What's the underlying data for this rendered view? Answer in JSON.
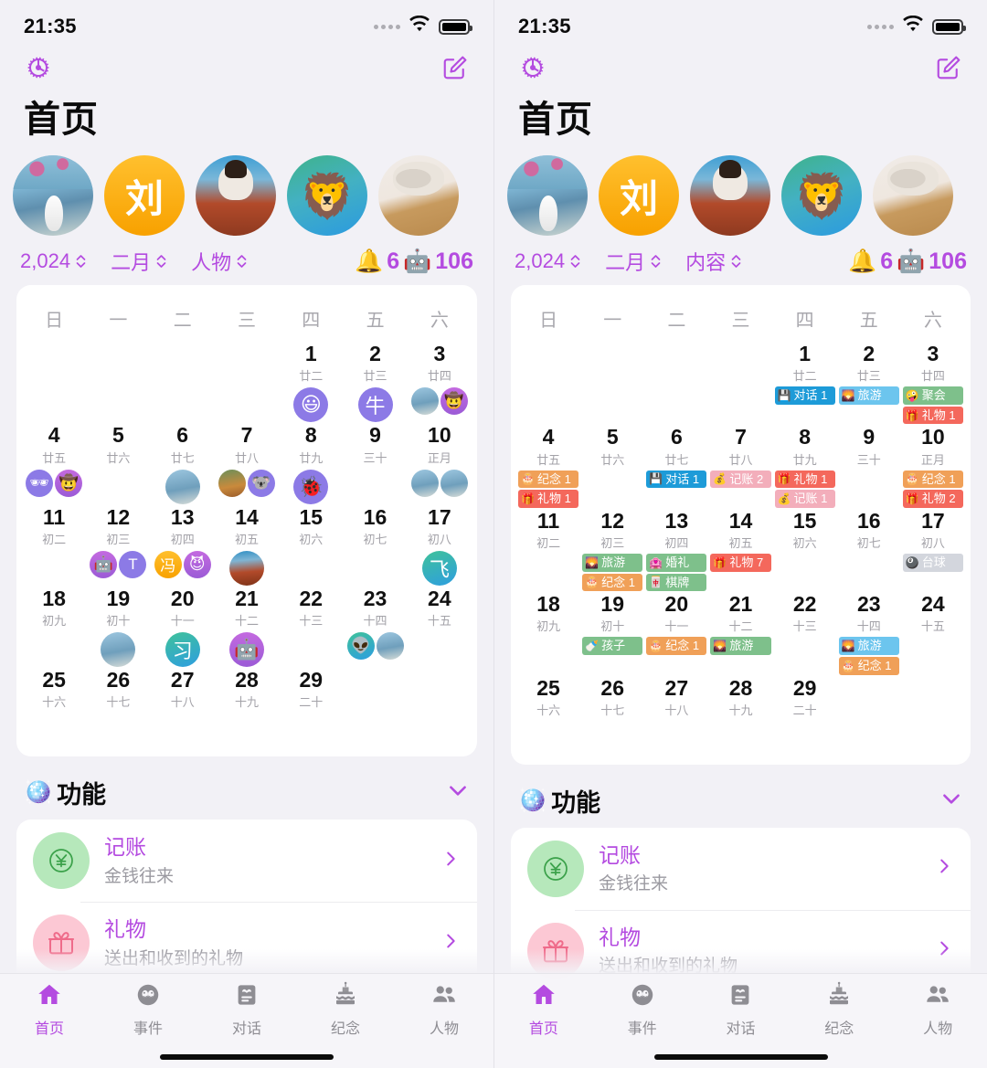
{
  "status_bar": {
    "time": "21:35",
    "wifi_icon": "wifi-icon",
    "battery_icon": "battery-icon"
  },
  "nav": {
    "settings_icon": "gear-icon",
    "compose_icon": "compose-icon"
  },
  "header": {
    "title": "首页"
  },
  "avatars": [
    {
      "name": "avatar-photo-lake",
      "kind": "photo",
      "label": ""
    },
    {
      "name": "avatar-letter-liu",
      "kind": "letter",
      "label": "刘"
    },
    {
      "name": "avatar-photo-cooking",
      "kind": "photo",
      "label": ""
    },
    {
      "name": "avatar-emoji-lion",
      "kind": "emoji",
      "label": "🦁"
    },
    {
      "name": "avatar-photo-table",
      "kind": "photo",
      "label": ""
    }
  ],
  "filters_left": [
    {
      "label": "2,024",
      "name": "year-selector"
    },
    {
      "label": "二月",
      "name": "month-selector"
    },
    {
      "label": "人物",
      "name": "view-selector"
    }
  ],
  "filters_right": [
    {
      "label": "2,024",
      "name": "year-selector"
    },
    {
      "label": "二月",
      "name": "month-selector"
    },
    {
      "label": "内容",
      "name": "view-selector"
    }
  ],
  "counters": {
    "bell_emoji": "🔔",
    "bell_count": "6",
    "robot_emoji": "🤖",
    "robot_count": "106"
  },
  "calendar": {
    "weekdays": [
      "日",
      "一",
      "二",
      "三",
      "四",
      "五",
      "六"
    ],
    "leading_blanks": 4,
    "days": [
      {
        "day": "1",
        "lunar": "廿二"
      },
      {
        "day": "2",
        "lunar": "廿三"
      },
      {
        "day": "3",
        "lunar": "廿四"
      },
      {
        "day": "4",
        "lunar": "廿五"
      },
      {
        "day": "5",
        "lunar": "廿六"
      },
      {
        "day": "6",
        "lunar": "廿七"
      },
      {
        "day": "7",
        "lunar": "廿八"
      },
      {
        "day": "8",
        "lunar": "廿九"
      },
      {
        "day": "9",
        "lunar": "三十"
      },
      {
        "day": "10",
        "lunar": "正月"
      },
      {
        "day": "11",
        "lunar": "初二"
      },
      {
        "day": "12",
        "lunar": "初三"
      },
      {
        "day": "13",
        "lunar": "初四"
      },
      {
        "day": "14",
        "lunar": "初五"
      },
      {
        "day": "15",
        "lunar": "初六"
      },
      {
        "day": "16",
        "lunar": "初七"
      },
      {
        "day": "17",
        "lunar": "初八"
      },
      {
        "day": "18",
        "lunar": "初九"
      },
      {
        "day": "19",
        "lunar": "初十"
      },
      {
        "day": "20",
        "lunar": "十一"
      },
      {
        "day": "21",
        "lunar": "十二"
      },
      {
        "day": "22",
        "lunar": "十三"
      },
      {
        "day": "23",
        "lunar": "十四"
      },
      {
        "day": "24",
        "lunar": "十五"
      },
      {
        "day": "25",
        "lunar": "十六"
      },
      {
        "day": "26",
        "lunar": "十七"
      },
      {
        "day": "27",
        "lunar": "十八"
      },
      {
        "day": "28",
        "lunar": "十九"
      },
      {
        "day": "29",
        "lunar": "二十"
      }
    ],
    "people_marks": {
      "1": [
        {
          "style": "d-purple",
          "glyph": "😃",
          "size": "big"
        }
      ],
      "2": [
        {
          "style": "d-purple",
          "glyph": "牛",
          "size": "big"
        }
      ],
      "3": [
        {
          "style": "d-pic1",
          "glyph": ""
        },
        {
          "style": "d-violet",
          "glyph": "🤠"
        }
      ],
      "4": [
        {
          "style": "d-purple",
          "glyph": "🕶"
        },
        {
          "style": "d-violet",
          "glyph": "🤠"
        }
      ],
      "6": [
        {
          "style": "d-pic1",
          "glyph": "",
          "size": "big"
        }
      ],
      "7": [
        {
          "style": "d-pic3",
          "glyph": ""
        },
        {
          "style": "d-purple",
          "glyph": "🐨"
        }
      ],
      "8": [
        {
          "style": "d-purple",
          "glyph": "🐞",
          "size": "big"
        }
      ],
      "10": [
        {
          "style": "d-pic1",
          "glyph": ""
        },
        {
          "style": "d-pic1",
          "glyph": ""
        }
      ],
      "12": [
        {
          "style": "d-violet",
          "glyph": "🤖"
        },
        {
          "style": "d-purple",
          "glyph": "T"
        }
      ],
      "13": [
        {
          "style": "d-orange",
          "glyph": "冯"
        },
        {
          "style": "d-violet",
          "glyph": "😈"
        }
      ],
      "14": [
        {
          "style": "d-pic2",
          "glyph": "",
          "size": "big"
        }
      ],
      "17": [
        {
          "style": "d-teal",
          "glyph": "飞",
          "size": "big"
        }
      ],
      "19": [
        {
          "style": "d-pic1",
          "glyph": "",
          "size": "big"
        }
      ],
      "20": [
        {
          "style": "d-teal",
          "glyph": "习",
          "size": "big"
        }
      ],
      "21": [
        {
          "style": "d-violet",
          "glyph": "🤖",
          "size": "big"
        }
      ],
      "23": [
        {
          "style": "d-teal",
          "glyph": "👽"
        },
        {
          "style": "d-pic1",
          "glyph": ""
        }
      ]
    },
    "events": {
      "1": [
        {
          "icon": "💾",
          "label": "对话 1",
          "color": "e-blue"
        }
      ],
      "2": [
        {
          "icon": "🌄",
          "label": "旅游",
          "color": "e-lightblue"
        }
      ],
      "3": [
        {
          "icon": "🤪",
          "label": "聚会",
          "color": "e-green"
        },
        {
          "icon": "🎁",
          "label": "礼物 1",
          "color": "e-red"
        }
      ],
      "4": [
        {
          "icon": "🎂",
          "label": "纪念 1",
          "color": "e-orange"
        },
        {
          "icon": "🎁",
          "label": "礼物 1",
          "color": "e-red"
        }
      ],
      "6": [
        {
          "icon": "💾",
          "label": "对话 1",
          "color": "e-blue"
        }
      ],
      "7": [
        {
          "icon": "💰",
          "label": "记账 2",
          "color": "e-pink"
        }
      ],
      "8": [
        {
          "icon": "🎁",
          "label": "礼物 1",
          "color": "e-red"
        },
        {
          "icon": "💰",
          "label": "记账 1",
          "color": "e-pink"
        }
      ],
      "10": [
        {
          "icon": "🎂",
          "label": "纪念 1",
          "color": "e-orange"
        },
        {
          "icon": "🎁",
          "label": "礼物 2",
          "color": "e-red"
        }
      ],
      "12": [
        {
          "icon": "🌄",
          "label": "旅游",
          "color": "e-green"
        },
        {
          "icon": "🎂",
          "label": "纪念 1",
          "color": "e-orange"
        }
      ],
      "13": [
        {
          "icon": "🏩",
          "label": "婚礼",
          "color": "e-green"
        },
        {
          "icon": "🀄",
          "label": "棋牌",
          "color": "e-green"
        }
      ],
      "14": [
        {
          "icon": "🎁",
          "label": "礼物 7",
          "color": "e-red"
        }
      ],
      "17": [
        {
          "icon": "🎱",
          "label": "台球",
          "color": "e-gray"
        }
      ],
      "19": [
        {
          "icon": "🍼",
          "label": "孩子",
          "color": "e-green"
        }
      ],
      "20": [
        {
          "icon": "🎂",
          "label": "纪念 1",
          "color": "e-orange"
        }
      ],
      "21": [
        {
          "icon": "🌄",
          "label": "旅游",
          "color": "e-green"
        }
      ],
      "23": [
        {
          "icon": "🌄",
          "label": "旅游",
          "color": "e-lightblue"
        },
        {
          "icon": "🎂",
          "label": "纪念 1",
          "color": "e-orange"
        }
      ]
    }
  },
  "functions": {
    "section_icon": "🪩",
    "section_title": "功能",
    "collapse_icon": "chevron-down-icon",
    "items": [
      {
        "name": "记账",
        "sub": "金钱往来",
        "icon": "yen-icon",
        "tone": "green"
      },
      {
        "name": "礼物",
        "sub": "送出和收到的礼物",
        "icon": "gift-icon",
        "tone": "pink"
      }
    ]
  },
  "tabbar": {
    "items": [
      {
        "label": "首页",
        "icon": "home-icon",
        "active": true
      },
      {
        "label": "事件",
        "icon": "masks-icon",
        "active": false
      },
      {
        "label": "对话",
        "icon": "card-icon",
        "active": false
      },
      {
        "label": "纪念",
        "icon": "cake-icon",
        "active": false
      },
      {
        "label": "人物",
        "icon": "people-icon",
        "active": false
      }
    ]
  },
  "colors": {
    "accent": "#b44be0",
    "bg": "#f2f1f6",
    "card": "#ffffff"
  }
}
